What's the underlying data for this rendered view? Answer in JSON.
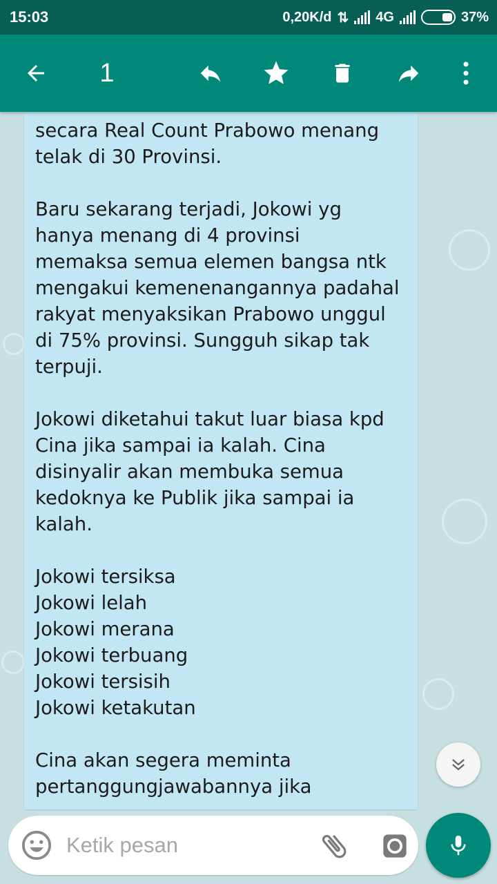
{
  "status_bar": {
    "time": "15:03",
    "speed": "0,20K/d",
    "network": "4G",
    "battery": "37%"
  },
  "toolbar": {
    "selected_count": "1",
    "icons": [
      "back-arrow-icon",
      "reply-icon",
      "star-icon",
      "delete-icon",
      "forward-icon",
      "more-vert-icon"
    ],
    "color": "#00897B"
  },
  "message": {
    "text": "secara Real Count Prabowo menang\ntelak di 30 Provinsi.\n\nBaru sekarang terjadi, Jokowi yg\nhanya menang di 4 provinsi\nmemaksa semua elemen bangsa ntk\nmengakui kemenenangannya padahal\nrakyat menyaksikan Prabowo unggul\ndi 75% provinsi. Sungguh sikap tak\nterpuji.\n\nJokowi diketahui takut luar biasa kpd\nCina jika sampai ia kalah. Cina\ndisinyalir akan membuka semua\nkedoknya ke Publik jika sampai ia\nkalah.\n\nJokowi tersiksa\nJokowi lelah\nJokowi merana\nJokowi terbuang\nJokowi tersisih\nJokowi ketakutan\n\nCina akan segera meminta\npertanggungjawabannya jika",
    "bubble_color": "#c2e6f3"
  },
  "input": {
    "placeholder": "Ketik pesan"
  },
  "colors": {
    "status_bar": "#075E54",
    "wallpaper": "#c8dfe2"
  }
}
